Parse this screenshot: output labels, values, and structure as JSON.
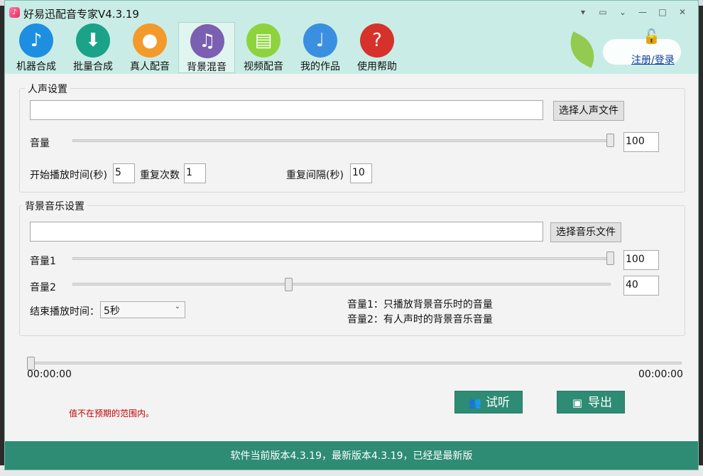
{
  "app": {
    "title": "好易迅配音专家V4.3.19",
    "logo_glyph": "♪"
  },
  "window_controls": [
    "▾",
    "▭",
    "⌄",
    "—",
    "□",
    "✕"
  ],
  "toolbar": [
    {
      "label": "机器合成",
      "icon": "music-note-icon",
      "glyph": "♪",
      "color": "#1e8fe0"
    },
    {
      "label": "批量合成",
      "icon": "mp3-download-icon",
      "glyph": "⬇",
      "color": "#1ba38a"
    },
    {
      "label": "真人配音",
      "icon": "person-icon",
      "glyph": "●",
      "color": "#f39a2a"
    },
    {
      "label": "背景混音",
      "icon": "music-equalizer-icon",
      "glyph": "♫",
      "color": "#7b5fb0",
      "active": true
    },
    {
      "label": "视频配音",
      "icon": "film-icon",
      "glyph": "▤",
      "color": "#8ed33e"
    },
    {
      "label": "我的作品",
      "icon": "eighth-note-icon",
      "glyph": "♩",
      "color": "#3a8fe0"
    },
    {
      "label": "使用帮助",
      "icon": "question-mark-icon",
      "glyph": "?",
      "color": "#d7312c"
    }
  ],
  "login": {
    "label": "注册/登录",
    "glyph": "🔓"
  },
  "voice": {
    "legend": "人声设置",
    "file_path": "",
    "choose_label": "选择人声文件",
    "volume_label": "音量",
    "volume_value": "100",
    "volume_level": 1.0,
    "start_label": "开始播放时间(秒)",
    "start_value": "5",
    "repeat_label": "重复次数",
    "repeat_value": "1",
    "interval_label": "重复间隔(秒)",
    "interval_value": "10"
  },
  "music": {
    "legend": "背景音乐设置",
    "file_path": "",
    "choose_label": "选择音乐文件",
    "volume1_label": "音量1",
    "volume1_value": "100",
    "volume1_level": 1.0,
    "volume2_label": "音量2",
    "volume2_value": "40",
    "volume2_level": 0.4,
    "end_label": "结束播放时间：",
    "end_value": "5秒",
    "note1": "音量1：只播放背景音乐时的音量",
    "note2": "音量2：有人声时的背景音乐音量"
  },
  "progress": {
    "start_time": "00:00:00",
    "end_time": "00:00:00",
    "level": 0
  },
  "actions": {
    "preview_label": "试听",
    "preview_glyph": "👥",
    "export_label": "导出",
    "export_glyph": "▣"
  },
  "error_message": "值不在预期的范围内。",
  "footer": {
    "text": "软件当前版本4.3.19，最新版本4.3.19，已经是最新版"
  },
  "colors": {
    "accent": "#2e8b74",
    "header_bg": "#c9ede6"
  }
}
